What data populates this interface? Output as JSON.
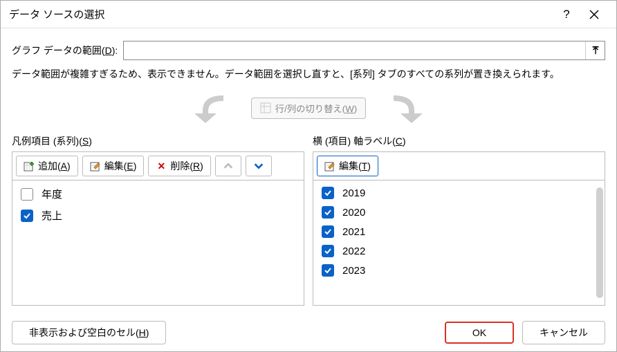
{
  "titlebar": {
    "title": "データ ソースの選択"
  },
  "range": {
    "label_pre": "グラフ データの範囲(",
    "label_key": "D",
    "label_post": "):"
  },
  "warning": "データ範囲が複雑すぎるため、表示できません。データ範囲を選択し直すと、[系列] タブのすべての系列が置き換えられます。",
  "switch": {
    "label_pre": "行/列の切り替え(",
    "label_key": "W",
    "label_post": ")"
  },
  "legend": {
    "title_pre": "凡例項目 (系列)(",
    "title_key": "S",
    "title_post": ")",
    "add_pre": "追加(",
    "add_key": "A",
    "add_post": ")",
    "edit_pre": "編集(",
    "edit_key": "E",
    "edit_post": ")",
    "del_pre": "削除(",
    "del_key": "R",
    "del_post": ")",
    "items": [
      {
        "label": "年度",
        "checked": false
      },
      {
        "label": "売上",
        "checked": true
      }
    ]
  },
  "axis": {
    "title_pre": "横 (項目) 軸ラベル(",
    "title_key": "C",
    "title_post": ")",
    "edit_pre": "編集(",
    "edit_key": "T",
    "edit_post": ")",
    "items": [
      {
        "label": "2019",
        "checked": true
      },
      {
        "label": "2020",
        "checked": true
      },
      {
        "label": "2021",
        "checked": true
      },
      {
        "label": "2022",
        "checked": true
      },
      {
        "label": "2023",
        "checked": true
      }
    ]
  },
  "footer": {
    "hidden_pre": "非表示および空白のセル(",
    "hidden_key": "H",
    "hidden_post": ")",
    "ok": "OK",
    "cancel": "キャンセル"
  }
}
